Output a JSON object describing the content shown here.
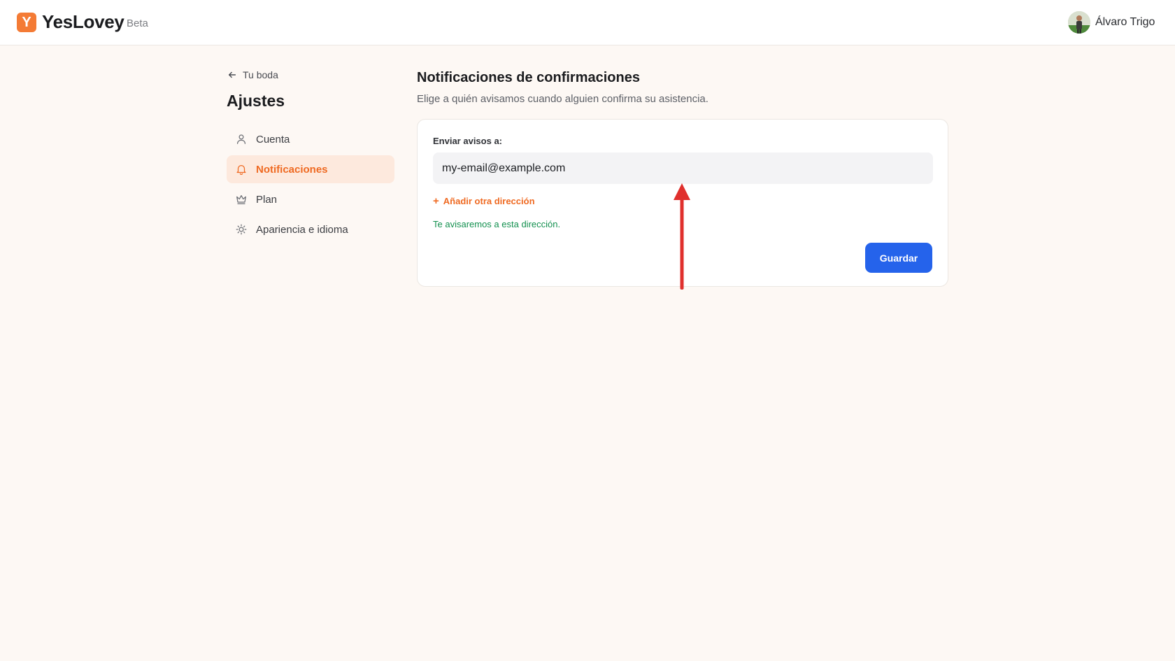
{
  "header": {
    "logo_letter": "Y",
    "brand": "YesLovey",
    "badge": "Beta",
    "user_name": "Álvaro Trigo"
  },
  "sidebar": {
    "back_label": "Tu boda",
    "title": "Ajustes",
    "items": [
      {
        "label": "Cuenta",
        "icon": "user-icon",
        "active": false
      },
      {
        "label": "Notificaciones",
        "icon": "bell-icon",
        "active": true
      },
      {
        "label": "Plan",
        "icon": "crown-icon",
        "active": false
      },
      {
        "label": "Apariencia e idioma",
        "icon": "sun-icon",
        "active": false
      }
    ]
  },
  "main": {
    "title": "Notificaciones de confirmaciones",
    "subtitle": "Elige a quién avisamos cuando alguien confirma su asistencia.",
    "form": {
      "label": "Enviar avisos a:",
      "email_value": "my-email@example.com",
      "add_label": "Añadir otra dirección",
      "confirmation": "Te avisaremos a esta dirección.",
      "save_label": "Guardar"
    }
  },
  "colors": {
    "accent": "#ef6a22",
    "primary_button": "#2563eb",
    "success_text": "#13904f",
    "annotation_arrow": "#e0302d",
    "page_background": "#fdf8f4"
  }
}
